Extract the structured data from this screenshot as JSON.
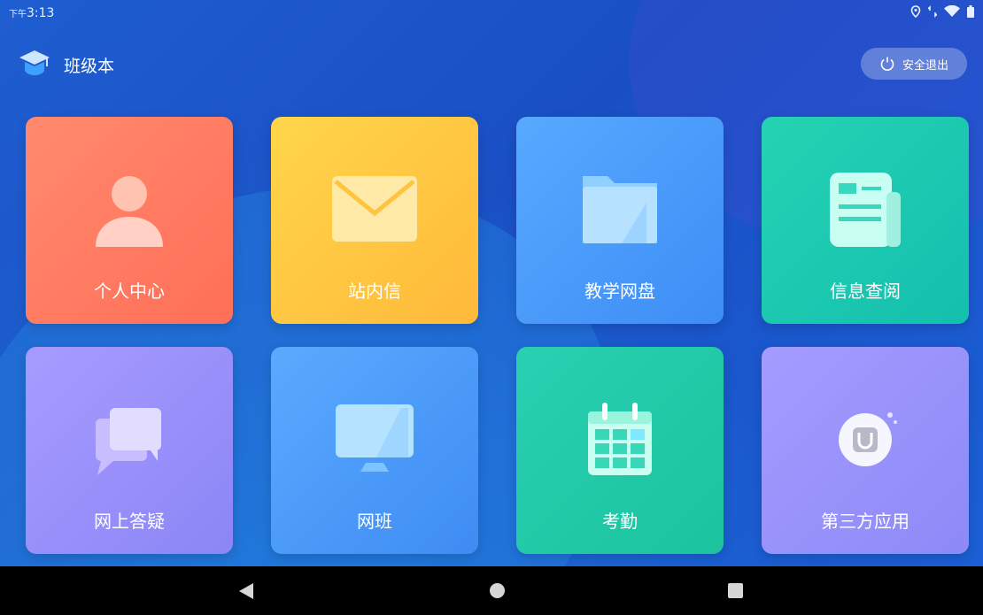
{
  "status": {
    "time_prefix": "下午",
    "time": "3:13",
    "icons": [
      "location-icon",
      "data-arrows-icon",
      "wifi-icon",
      "battery-icon"
    ]
  },
  "header": {
    "title": "班级本",
    "logo_icon": "graduation-cap-icon",
    "logout_label": "安全退出",
    "logout_icon": "power-icon"
  },
  "tiles": [
    {
      "label": "个人中心",
      "icon": "person-icon",
      "gradient": [
        "#ff8a6e",
        "#ff6f57"
      ]
    },
    {
      "label": "站内信",
      "icon": "envelope-icon",
      "gradient": [
        "#ffd64a",
        "#ffb93a"
      ]
    },
    {
      "label": "教学网盘",
      "icon": "folder-icon",
      "gradient": [
        "#58a9ff",
        "#3d8df6"
      ]
    },
    {
      "label": "信息查阅",
      "icon": "newspaper-icon",
      "gradient": [
        "#25d3b3",
        "#14bfae"
      ]
    },
    {
      "label": "网上答疑",
      "icon": "chat-bubbles-icon",
      "gradient": [
        "#a79bff",
        "#8b86f6"
      ]
    },
    {
      "label": "网班",
      "icon": "monitor-icon",
      "gradient": [
        "#5aaaff",
        "#3e8cf3"
      ]
    },
    {
      "label": "考勤",
      "icon": "calendar-icon",
      "gradient": [
        "#29d0b2",
        "#1cc39e"
      ]
    },
    {
      "label": "第三方应用",
      "icon": "app-u-icon",
      "gradient": [
        "#a49cff",
        "#8d89f7"
      ]
    }
  ],
  "navbar": {
    "icons": [
      "back-icon",
      "home-icon",
      "recents-icon"
    ]
  }
}
